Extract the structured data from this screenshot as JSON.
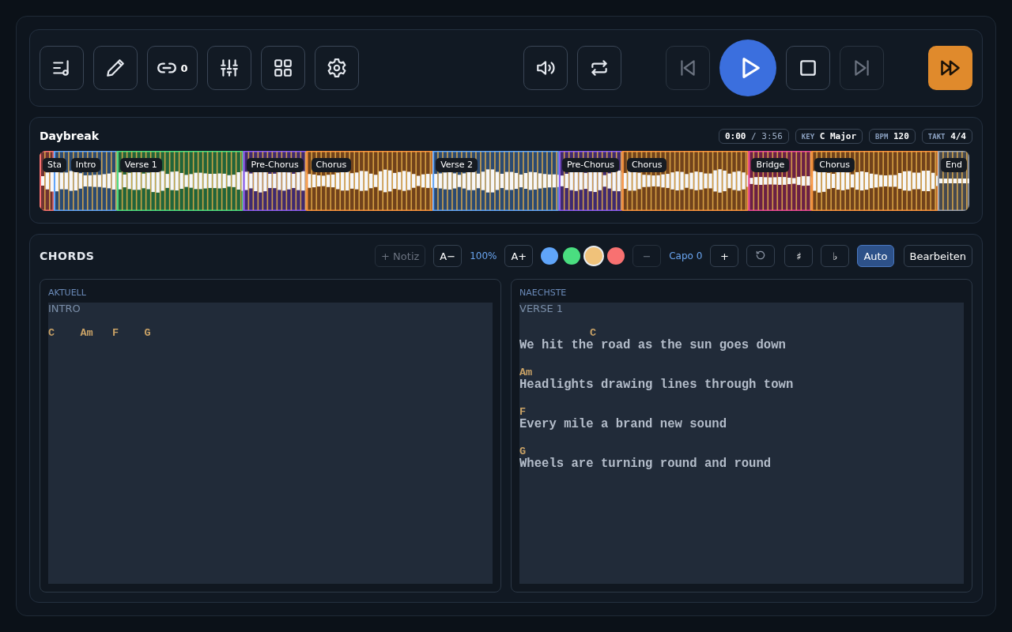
{
  "toolbar": {
    "link_count": "0"
  },
  "transport": {
    "previous": {
      "disabled": true
    },
    "play": {
      "playing": false
    },
    "stop": {
      "disabled": false
    },
    "next": {
      "disabled": true
    },
    "fast_forward": {
      "active": true
    }
  },
  "song": {
    "title": "Daybreak",
    "time_current": "0:00",
    "time_separator": "/",
    "time_total": "3:56",
    "key_label": "KEY",
    "key": "C Major",
    "bpm_label": "BPM",
    "bpm": "120",
    "meter_label": "TAKT",
    "meter": "4/4"
  },
  "sections": [
    {
      "label": "Sta",
      "kind": "start",
      "color": "#f87171"
    },
    {
      "label": "Intro",
      "kind": "intro",
      "color": "#60a5fa"
    },
    {
      "label": "Verse 1",
      "kind": "verse",
      "color": "#4ade80"
    },
    {
      "label": "Pre-Chorus",
      "kind": "prechorus",
      "color": "#8b5cf6"
    },
    {
      "label": "Chorus",
      "kind": "chorus",
      "color": "#fb923c"
    },
    {
      "label": "Verse 2",
      "kind": "verse",
      "color": "#60a5fa"
    },
    {
      "label": "Pre-Chorus",
      "kind": "prechorus",
      "color": "#8b5cf6"
    },
    {
      "label": "Chorus",
      "kind": "chorus",
      "color": "#fb923c"
    },
    {
      "label": "Bridge",
      "kind": "bridge",
      "color": "#ec4899"
    },
    {
      "label": "Chorus",
      "kind": "chorus",
      "color": "#fb923c"
    },
    {
      "label": "End",
      "kind": "end",
      "color": "#9ca3af"
    }
  ],
  "chords_panel": {
    "title": "CHORDS",
    "note_button": {
      "label": "+ Notiz",
      "disabled": true
    },
    "font_smaller": "A−",
    "zoom": "100%",
    "font_larger": "A+",
    "colors": [
      {
        "color": "#60a5fa",
        "selected": false
      },
      {
        "color": "#4ade80",
        "selected": false
      },
      {
        "color": "#f0c27a",
        "selected": true
      },
      {
        "color": "#f87171",
        "selected": false
      }
    ],
    "capo_minus": {
      "label": "−",
      "disabled": true
    },
    "capo": "Capo 0",
    "capo_plus": {
      "label": "+",
      "disabled": false
    },
    "sharp": "♯",
    "flat": "♭",
    "auto": {
      "label": "Auto",
      "selected": true
    },
    "edit": "Bearbeiten",
    "panes": [
      {
        "heading": "AKTUELL",
        "section": "INTRO",
        "lines": [
          {
            "chords": "C    Am   F    G"
          }
        ]
      },
      {
        "heading": "NAECHSTE",
        "section": "VERSE 1",
        "lines": [
          {
            "chords": "           C",
            "lyrics": "We hit the road as the sun goes down"
          },
          {
            "chords": "Am",
            "lyrics": "Headlights drawing lines through town"
          },
          {
            "chords": "F",
            "lyrics": "Every mile a brand new sound"
          },
          {
            "chords": "G",
            "lyrics": "Wheels are turning round and round"
          }
        ]
      }
    ]
  }
}
